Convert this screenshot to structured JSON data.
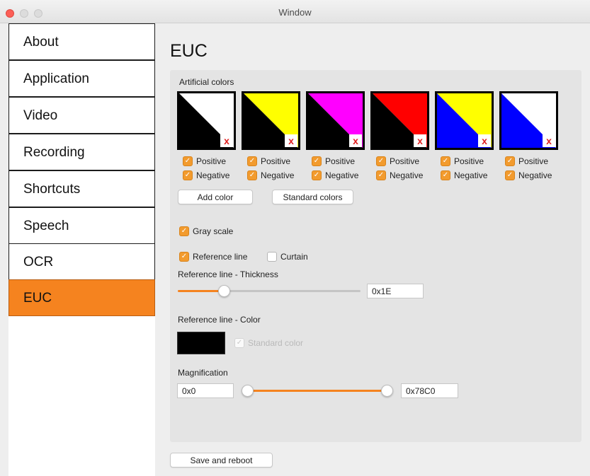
{
  "window": {
    "title": "Window"
  },
  "sidebar": {
    "items": [
      {
        "label": "About"
      },
      {
        "label": "Application"
      },
      {
        "label": "Video"
      },
      {
        "label": "Recording"
      },
      {
        "label": "Shortcuts"
      },
      {
        "label": "Speech"
      },
      {
        "label": "OCR"
      },
      {
        "label": "EUC",
        "selected": true
      }
    ]
  },
  "page": {
    "title": "EUC"
  },
  "artificial_colors": {
    "label": "Artificial colors",
    "swatches": [
      {
        "upper": "#ffffff",
        "lower": "#000000",
        "positive": true,
        "negative": true
      },
      {
        "upper": "#ffff00",
        "lower": "#000000",
        "positive": true,
        "negative": true
      },
      {
        "upper": "#ff00ff",
        "lower": "#000000",
        "positive": true,
        "negative": true
      },
      {
        "upper": "#ff0000",
        "lower": "#000000",
        "positive": true,
        "negative": true
      },
      {
        "upper": "#ffff00",
        "lower": "#0000ff",
        "positive": true,
        "negative": true
      },
      {
        "upper": "#ffffff",
        "lower": "#0000ff",
        "positive": true,
        "negative": true
      }
    ],
    "delete_glyph": "x",
    "positive_label": "Positive",
    "negative_label": "Negative",
    "add_button": "Add color",
    "standard_button": "Standard colors"
  },
  "gray_scale": {
    "label": "Gray scale",
    "checked": true
  },
  "reference_line": {
    "label": "Reference line",
    "checked": true
  },
  "curtain": {
    "label": "Curtain",
    "checked": false
  },
  "thickness": {
    "label": "Reference line - Thickness",
    "value": "0x1E"
  },
  "line_color": {
    "label": "Reference line - Color",
    "color": "#000000",
    "standard_label": "Standard color",
    "standard_checked": true,
    "standard_enabled": false
  },
  "magnification": {
    "label": "Magnification",
    "min": "0x0",
    "max": "0x78C0"
  },
  "footer": {
    "save_button": "Save and reboot"
  },
  "accent_color": "#f5831f",
  "check_glyph": "✓"
}
